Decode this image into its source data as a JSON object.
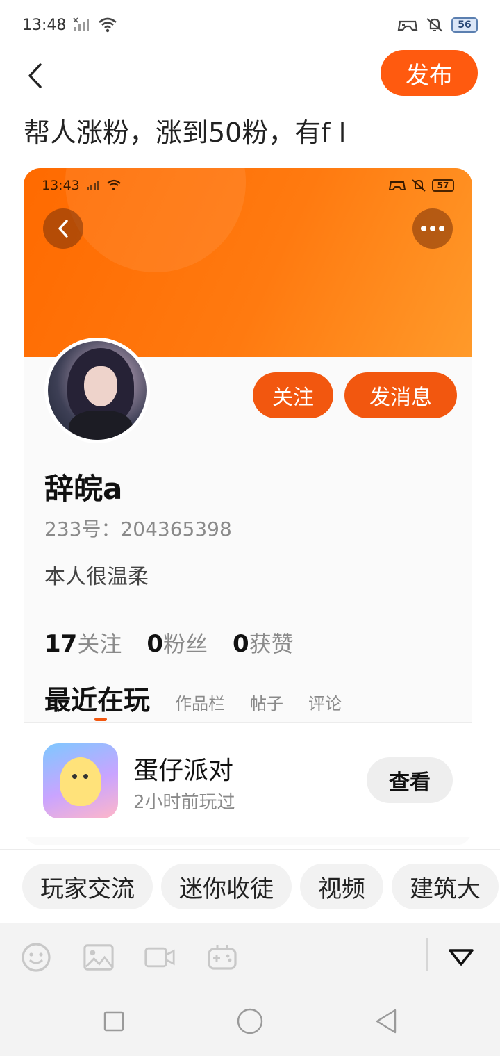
{
  "status_bar": {
    "time": "13:48",
    "battery": "56"
  },
  "header": {
    "publish_label": "发布"
  },
  "post": {
    "title": "帮人涨粉，涨到50粉，有f l"
  },
  "screenshot": {
    "status": {
      "time": "13:43",
      "battery": "57"
    },
    "profile": {
      "follow_label": "关注",
      "message_label": "发消息",
      "nickname": "辞皖a",
      "uid": "233号：204365398",
      "bio": "本人很温柔",
      "stats": [
        {
          "num": "17",
          "label": "关注"
        },
        {
          "num": "0",
          "label": "粉丝"
        },
        {
          "num": "0",
          "label": "获赞"
        }
      ],
      "tabs": [
        "最近在玩",
        "作品栏",
        "帖子",
        "评论"
      ]
    },
    "game": {
      "name": "蛋仔派对",
      "subtitle": "2小时前玩过",
      "view_label": "查看"
    }
  },
  "tags": [
    "玩家交流",
    "迷你收徒",
    "视频",
    "建筑大"
  ],
  "toolbar": {
    "icons": [
      "emoji-icon",
      "image-icon",
      "video-icon",
      "gamepad-icon",
      "collapse-icon"
    ]
  },
  "nav": {
    "icons": [
      "recent-apps-icon",
      "home-icon",
      "back-icon"
    ]
  }
}
